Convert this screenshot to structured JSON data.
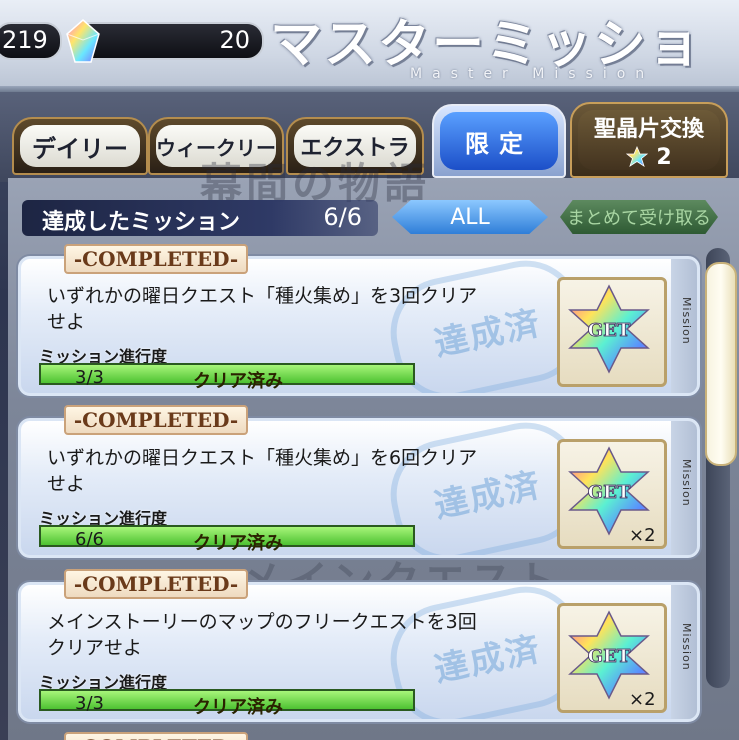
{
  "header": {
    "qp_value": "219",
    "quartz_value": "20",
    "title": "マスターミッション",
    "subtitle": "Master Mission"
  },
  "tabs": [
    {
      "label": "デイリー",
      "active": false
    },
    {
      "label": "ウィークリー",
      "active": false
    },
    {
      "label": "エクストラ",
      "active": false
    },
    {
      "label": "限定",
      "active": true
    }
  ],
  "exchange": {
    "label": "聖晶片交換",
    "count": "2"
  },
  "summary": {
    "label": "達成したミッション",
    "count": "6/6"
  },
  "filter": {
    "label": "ALL"
  },
  "collect_all": {
    "label": "まとめて受け取る"
  },
  "background_text": [
    "幕間の物語",
    "メインクエスト"
  ],
  "missions": [
    {
      "completed_label": "-COMPLETED-",
      "description": "いずれかの曜日クエスト「種火集め」を3回クリアせよ",
      "progress_label": "ミッション進行度",
      "progress": "3/3",
      "progress_fraction": 1.0,
      "status": "クリア済み",
      "stamp": "達成済",
      "side_label": "Mission",
      "reward_label": "GET",
      "reward_multiplier": ""
    },
    {
      "completed_label": "-COMPLETED-",
      "description": "いずれかの曜日クエスト「種火集め」を6回クリアせよ",
      "progress_label": "ミッション進行度",
      "progress": "6/6",
      "progress_fraction": 1.0,
      "status": "クリア済み",
      "stamp": "達成済",
      "side_label": "Mission",
      "reward_label": "GET",
      "reward_multiplier": "×2"
    },
    {
      "completed_label": "-COMPLETED-",
      "description": "メインストーリーのマップのフリークエストを3回クリアせよ",
      "progress_label": "ミッション進行度",
      "progress": "3/3",
      "progress_fraction": 1.0,
      "status": "クリア済み",
      "stamp": "達成済",
      "side_label": "Mission",
      "reward_label": "GET",
      "reward_multiplier": "×2"
    }
  ],
  "colors": {
    "accent_blue": "#2f7ed8",
    "progress_green": "#4ec232",
    "gold_border": "#b48d4e"
  }
}
